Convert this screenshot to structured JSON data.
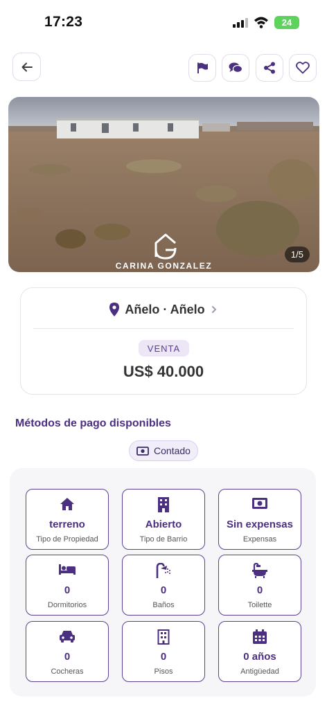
{
  "status_bar": {
    "time": "17:23",
    "battery": "24"
  },
  "listing": {
    "photo_counter": "1/5",
    "watermark": "CARINA GONZALEZ",
    "location": "Añelo · Añelo",
    "operation": "VENTA",
    "price": "US$ 40.000"
  },
  "payment": {
    "title": "Métodos de pago disponibles",
    "methods": [
      "Contado"
    ]
  },
  "features": [
    {
      "value": "terreno",
      "label": "Tipo de Propiedad",
      "icon": "house-icon"
    },
    {
      "value": "Abierto",
      "label": "Tipo de Barrio",
      "icon": "building-icon"
    },
    {
      "value": "Sin expensas",
      "label": "Expensas",
      "icon": "money-icon"
    },
    {
      "value": "0",
      "label": "Dormitorios",
      "icon": "bed-icon"
    },
    {
      "value": "0",
      "label": "Baños",
      "icon": "shower-icon"
    },
    {
      "value": "0",
      "label": "Toilette",
      "icon": "bathtub-icon"
    },
    {
      "value": "0",
      "label": "Cocheras",
      "icon": "car-icon"
    },
    {
      "value": "0",
      "label": "Pisos",
      "icon": "floors-icon"
    },
    {
      "value": "0 años",
      "label": "Antigüedad",
      "icon": "calendar-icon"
    }
  ],
  "colors": {
    "accent": "#4b2f80",
    "badge_bg": "#ece6f7"
  }
}
